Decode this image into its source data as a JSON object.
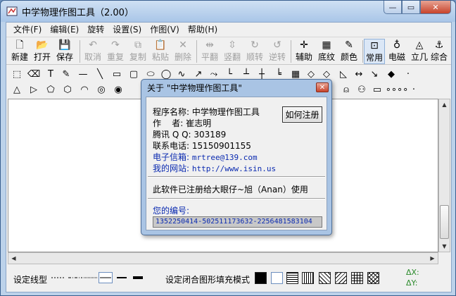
{
  "window": {
    "title": "中学物理作图工具（2.00）",
    "min": "—",
    "max": "▭",
    "close": "✕"
  },
  "menu": [
    "文件(F)",
    "编辑(E)",
    "旋转",
    "设置(S)",
    "作图(V)",
    "帮助(H)"
  ],
  "toolbar": [
    {
      "label": "新建",
      "icon": "🗋",
      "enabled": true
    },
    {
      "label": "打开",
      "icon": "📂",
      "enabled": true
    },
    {
      "label": "保存",
      "icon": "💾",
      "enabled": true
    },
    {
      "label": "取消",
      "icon": "↶",
      "enabled": false
    },
    {
      "label": "重复",
      "icon": "↷",
      "enabled": false
    },
    {
      "label": "复制",
      "icon": "⧉",
      "enabled": false
    },
    {
      "label": "粘贴",
      "icon": "📋",
      "enabled": false
    },
    {
      "label": "删除",
      "icon": "✕",
      "enabled": false
    },
    {
      "label": "平翻",
      "icon": "⇹",
      "enabled": false
    },
    {
      "label": "竖翻",
      "icon": "⇳",
      "enabled": false
    },
    {
      "label": "顺转",
      "icon": "↻",
      "enabled": false
    },
    {
      "label": "逆转",
      "icon": "↺",
      "enabled": false
    },
    {
      "label": "辅助",
      "icon": "✛",
      "enabled": true
    },
    {
      "label": "底纹",
      "icon": "▦",
      "enabled": true
    },
    {
      "label": "颜色",
      "icon": "✎",
      "enabled": true
    },
    {
      "label": "常用",
      "icon": "⊡",
      "enabled": true,
      "selected": true
    },
    {
      "label": "电磁",
      "icon": "♁",
      "enabled": true
    },
    {
      "label": "立几",
      "icon": "◬",
      "enabled": true
    },
    {
      "label": "综合",
      "icon": "⚓",
      "enabled": true
    }
  ],
  "shapes_row1": [
    "⬚",
    "⌫",
    "T",
    "✎",
    "—",
    "╲",
    "▭",
    "▢",
    "⬭",
    "◯",
    "∿",
    "↗",
    "⤳",
    "└",
    "┴",
    "┼",
    "╘",
    "▦",
    "◇",
    "◇",
    "◺",
    "↔",
    "↘",
    "◆",
    "·"
  ],
  "shapes_row2": [
    "△",
    "▷",
    "⬠",
    "⬡",
    "◠",
    "◎",
    "◉",
    "⍝",
    "⚇",
    "▭",
    "∘∘∘∘",
    "·"
  ],
  "status": {
    "line_label": "设定线型",
    "fill_label": "设定闭合图形填充模式",
    "coord_x": "ΔX:",
    "coord_y": "ΔY:"
  },
  "dialog": {
    "title": "关于 \"中学物理作图工具\"",
    "close": "✕",
    "register_button": "如何注册",
    "program_label": "程序名称:",
    "program_value": "中学物理作图工具",
    "author_label": "作    者:",
    "author_value": "崔志明",
    "qq_label": "腾讯 Q Q:",
    "qq_value": "303189",
    "phone_label": "联系电话:",
    "phone_value": "15150901155",
    "email_label": "电子信箱:",
    "email_value": "mrtree@139.com",
    "site_label": "我的网站:",
    "site_value": "http://www.isin.us",
    "license_text": "此软件已注册给大眼仔~旭（Anan）使用",
    "code_label": "您的编号:",
    "code_value": "1352250414-502511173632-2256481583104"
  }
}
